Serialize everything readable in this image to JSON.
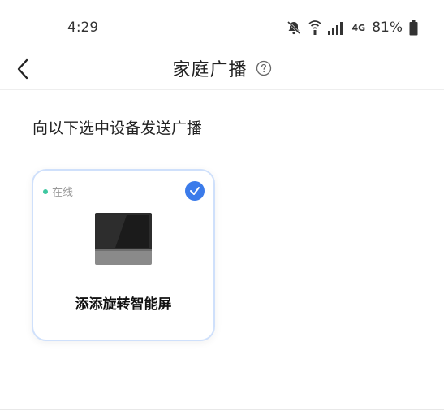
{
  "status_bar": {
    "time": "4:29",
    "network": "4G",
    "battery": "81%",
    "icons": [
      "bell-off-icon",
      "wifi-icon",
      "signal-icon",
      "battery-icon"
    ]
  },
  "header": {
    "title": "家庭广播",
    "back_icon": "chevron-left-icon",
    "help_icon": "question-circle-icon"
  },
  "main": {
    "instruction": "向以下选中设备发送广播",
    "devices": [
      {
        "status": "在线",
        "name": "添添旋转智能屏",
        "selected": true
      }
    ]
  },
  "colors": {
    "accent": "#3b7bea",
    "online": "#3ec7a0",
    "card_border": "#cfe0fb"
  }
}
